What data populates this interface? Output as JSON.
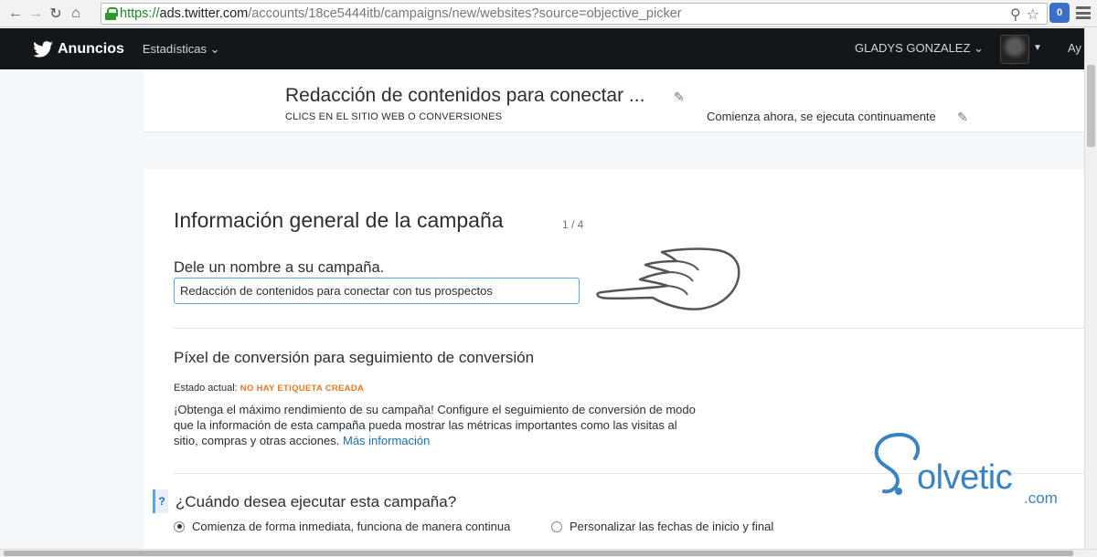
{
  "browser": {
    "url_scheme": "https://",
    "url_host": "ads.twitter.com",
    "url_path": "/accounts/18ce5444itb/campaigns/new/websites?source=objective_picker",
    "extension_badge": "0"
  },
  "topbar": {
    "brand": "Anuncios",
    "stats_menu": "Estadísticas",
    "user_name": "GLADYS GONZALEZ",
    "help_cutoff": "Ay"
  },
  "campaign_header": {
    "title": "Redacción de contenidos para conectar ...",
    "objective": "CLICS EN EL SITIO WEB O CONVERSIONES",
    "schedule": "Comienza ahora, se ejecuta continuamente"
  },
  "form": {
    "section_title": "Información general de la campaña",
    "step": "1 / 4",
    "name_label": "Dele un nombre a su campaña.",
    "name_value": "Redacción de contenidos para conectar con tus prospectos",
    "pixel_title": "Píxel de conversión para seguimiento de conversión",
    "status_label": "Estado actual:",
    "status_value": "NO HAY ETIQUETA CREADA",
    "pixel_description": "¡Obtenga el máximo rendimiento de su campaña! Configure el seguimiento de conversión de modo que la información de esta campaña pueda mostrar las métricas importantes como las visitas al sitio, compras y otras acciones.",
    "more_info_link": "Más información",
    "when_help": "?",
    "when_title": "¿Cuándo desea ejecutar esta campaña?",
    "option_immediate": "Comienza de forma inmediata, funciona de manera continua",
    "option_custom": "Personalizar las fechas de inicio y final",
    "selected_option": "immediate"
  },
  "watermark": {
    "text": "olvetic",
    "suffix": ".com"
  },
  "colors": {
    "topbar_bg": "#14171a",
    "status_orange": "#e87722",
    "link_blue": "#1b6fb5",
    "input_focus": "#5aa3e6"
  }
}
